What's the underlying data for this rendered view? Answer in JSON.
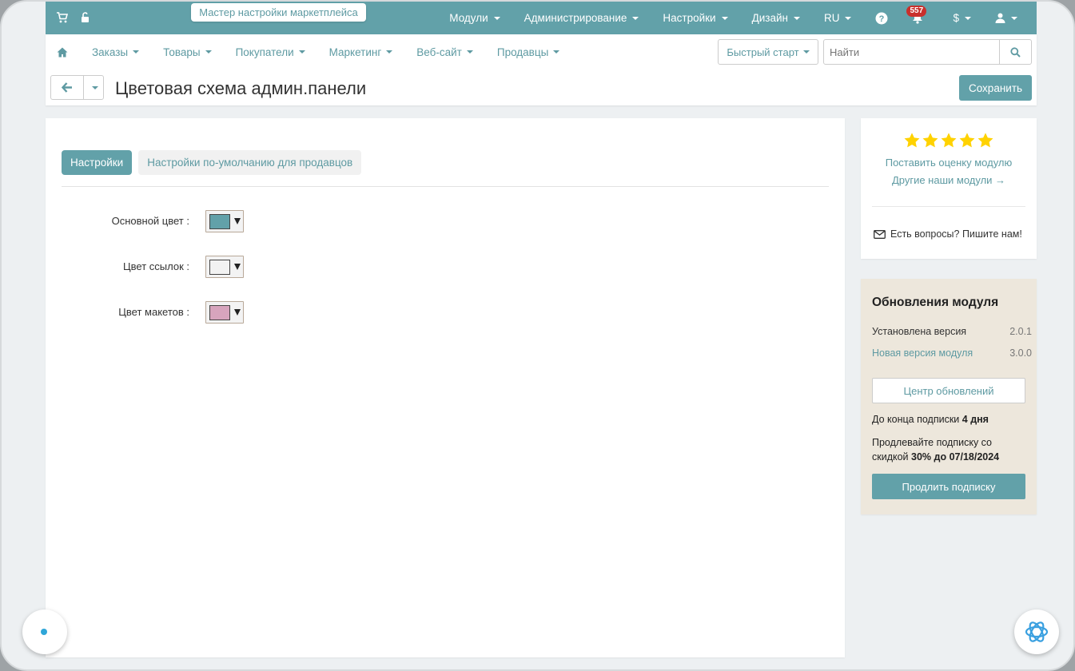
{
  "topbar": {
    "wizard_label": "Мастер настройки маркетплейса",
    "menu": [
      "Модули",
      "Администрирование",
      "Настройки",
      "Дизайн",
      "RU"
    ],
    "notifications_count": "557",
    "currency": "$",
    "colors": {
      "bar": "#62a1a9"
    }
  },
  "subnav": {
    "items": [
      "Заказы",
      "Товары",
      "Покупатели",
      "Маркетинг",
      "Веб-сайт",
      "Продавцы"
    ],
    "quick_start": "Быстрый старт",
    "search_placeholder": "Найти"
  },
  "page": {
    "title": "Цветовая схема админ.панели",
    "save_label": "Сохранить"
  },
  "tabs": [
    {
      "label": "Настройки",
      "active": true
    },
    {
      "label": "Настройки по-умолчанию для продавцов",
      "active": false
    }
  ],
  "fields": [
    {
      "label": "Основной цвет :",
      "color": "#62a1a9"
    },
    {
      "label": "Цвет ссылок :",
      "color": "#f2f2f2"
    },
    {
      "label": "Цвет макетов :",
      "color": "#d7a4bd"
    }
  ],
  "rating": {
    "stars": 5,
    "rate_link": "Поставить оценку модулю",
    "other_modules": "Другие наши модули →",
    "contact": "Есть вопросы? Пишите нам!"
  },
  "updates": {
    "title": "Обновления модуля",
    "installed_label": "Установлена версия",
    "installed_value": "2.0.1",
    "new_label": "Новая версия модуля",
    "new_value": "3.0.0",
    "center_button": "Центр обновлений",
    "sub_end_prefix": "До конца подписки",
    "sub_end_value": "4 дня",
    "renew_text_1": "Продлевайте подписку со скидкой",
    "renew_discount": "30% до 07/18/2024",
    "extend_button": "Продлить подписку"
  }
}
